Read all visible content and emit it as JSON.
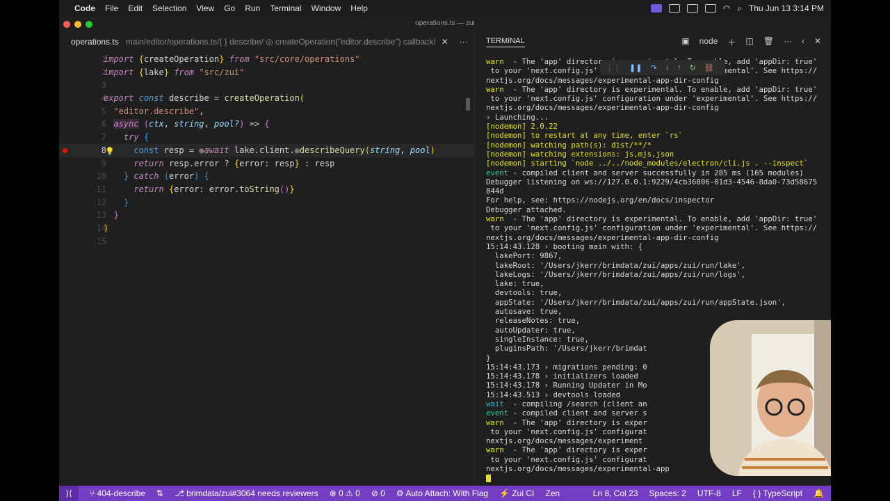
{
  "menubar": {
    "app_name": "Code",
    "items": [
      "File",
      "Edit",
      "Selection",
      "View",
      "Go",
      "Run",
      "Terminal",
      "Window",
      "Help"
    ],
    "clock": "Thu Jun 13  3:14 PM"
  },
  "window": {
    "title": "operations.ts — zui"
  },
  "editor": {
    "tab_filename": "operations.ts",
    "breadcrumb": "main/editor/operations.ts/{ } describe/ ◎ createOperation(\"editor.describe\") callback/",
    "current_line": "8"
  },
  "terminal": {
    "tab_label": "TERMINAL",
    "shell": "node",
    "lines": [
      "warn  - The 'app' directory is experimental. To enable, add 'appDir: true'",
      " to your 'next.config.js' configuration under 'experimental'. See https://",
      "nextjs.org/docs/messages/experimental-app-dir-config",
      "warn  - The 'app' directory is experimental. To enable, add 'appDir: true'",
      " to your 'next.config.js' configuration under 'experimental'. See https://",
      "nextjs.org/docs/messages/experimental-app-dir-config",
      "› Launching...",
      "[nodemon] 2.0.22",
      "[nodemon] to restart at any time, enter `rs`",
      "[nodemon] watching path(s): dist/**/*",
      "[nodemon] watching extensions: js,mjs,json",
      "[nodemon] starting `node ../../node_modules/electron/cli.js . --inspect`",
      "event - compiled client and server successfully in 285 ms (165 modules)",
      "Debugger listening on ws://127.0.0.1:9229/4cb36806-01d3-4546-8da0-73d58675",
      "844d",
      "For help, see: https://nodejs.org/en/docs/inspector",
      "Debugger attached.",
      "warn  - The 'app' directory is experimental. To enable, add 'appDir: true'",
      " to your 'next.config.js' configuration under 'experimental'. See https://",
      "nextjs.org/docs/messages/experimental-app-dir-config",
      "15:14:43.128 › booting main with: {",
      "  lakePort: 9867,",
      "  lakeRoot: '/Users/jkerr/brimdata/zui/apps/zui/run/lake',",
      "  lakeLogs: '/Users/jkerr/brimdata/zui/apps/zui/run/logs',",
      "  lake: true,",
      "  devtools: true,",
      "  appState: '/Users/jkerr/brimdata/zui/apps/zui/run/appState.json',",
      "  autosave: true,",
      "  releaseNotes: true,",
      "  autoUpdater: true,",
      "  singleInstance: true,",
      "  pluginsPath: '/Users/jkerr/brimdat",
      "}",
      "15:14:43.173 › migrations pending: 0",
      "15:14:43.178 › initializers loaded",
      "15:14:43.178 › Running Updater in Mo",
      "15:14:43.513 › devtools loaded",
      "wait  - compiling /search (client an",
      "event - compiled client and server s                                  s)",
      "warn  - The 'app' directory is exper                                  ue'",
      " to your 'next.config.js' configurat                                  ://",
      "nextjs.org/docs/messages/experiment",
      "warn  - The 'app' directory is exper                                  ue'",
      " to your 'next.config.js' configurat                                  s://",
      "nextjs.org/docs/messages/experimental-app"
    ]
  },
  "statusbar": {
    "branch": "404-describe",
    "pr": "brimdata/zui#3064 needs reviewers",
    "errors": "0",
    "warnings": "0",
    "ports": "0",
    "auto_attach": "Auto Attach: With Flag",
    "ci": "Zui CI",
    "theme": "Zen",
    "position": "Ln 8, Col 23",
    "spaces": "Spaces: 2",
    "encoding": "UTF-8",
    "eol": "LF",
    "language": "TypeScript"
  }
}
